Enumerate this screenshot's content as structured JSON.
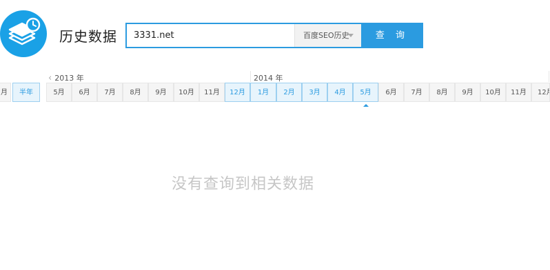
{
  "header": {
    "logo_icon": "stack-clock-icon",
    "title": "历史数据"
  },
  "search": {
    "value": "3331.net",
    "select_value": "百度SEO历史",
    "button_label": "查 询"
  },
  "timeline": {
    "year_2013": "2013 年",
    "year_2014": "2014 年",
    "left_edge_partial": "月",
    "half_year": "半年",
    "months_2013": [
      "5月",
      "6月",
      "7月",
      "8月",
      "9月",
      "10月",
      "11月",
      "12月"
    ],
    "months_2014": [
      "1月",
      "2月",
      "3月",
      "4月",
      "5月",
      "6月",
      "7月",
      "8月",
      "9月",
      "10月",
      "11月",
      "12月"
    ],
    "highlighted": [
      "2013-12",
      "2014-1",
      "2014-2",
      "2014-3",
      "2014-4",
      "2014-5"
    ],
    "selected": "2014-5"
  },
  "empty_message": "没有查询到相关数据",
  "colors": {
    "accent": "#2b9be0",
    "logo": "#1aa1e6",
    "highlight_bg": "#e7f4fc",
    "empty_text": "#c6c6c6"
  }
}
